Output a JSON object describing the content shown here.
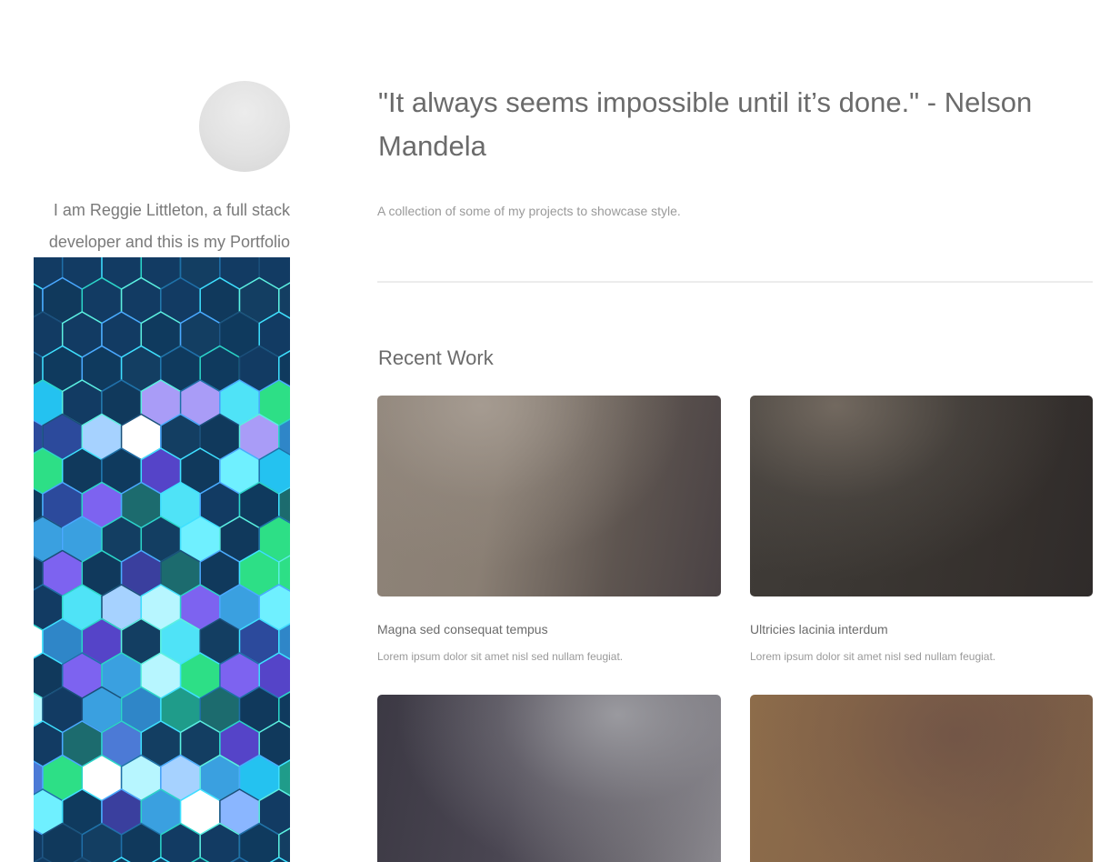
{
  "sidebar": {
    "bio_line1": "I am Reggie Littleton, a full stack",
    "bio_line2": "developer and this is my Portfolio"
  },
  "header": {
    "quote": "\"It always seems impossible until it’s done.\" - Nelson Mandela",
    "subtitle": "A collection of some of my projects to showcase style."
  },
  "recent_work": {
    "title": "Recent Work",
    "items": [
      {
        "title": "Magna sed consequat tempus",
        "description": "Lorem ipsum dolor sit amet nisl sed nullam feugiat."
      },
      {
        "title": "Ultricies lacinia interdum",
        "description": "Lorem ipsum dolor sit amet nisl sed nullam feugiat."
      },
      {
        "title": "",
        "description": ""
      },
      {
        "title": "",
        "description": ""
      }
    ]
  },
  "colors": {
    "text": "#6b6b6b",
    "muted": "#9a9a9a",
    "divider": "#ececec",
    "banner_bg": "#0f3558"
  }
}
